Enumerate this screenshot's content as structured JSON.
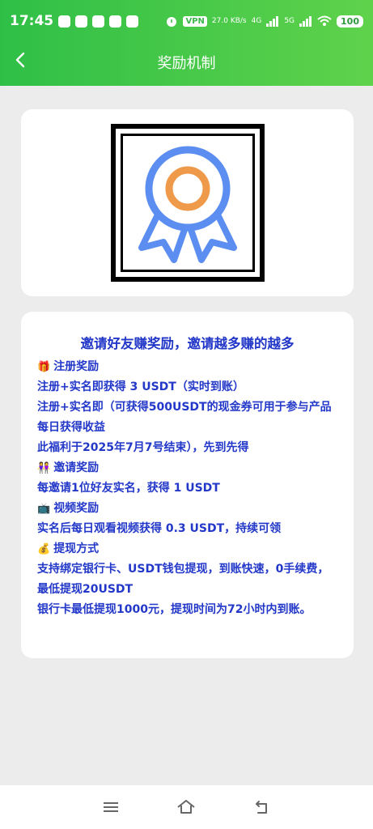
{
  "status_bar": {
    "time": "17:45",
    "vpn": "VPN",
    "speed": "27.0 KB/s",
    "network_4g": "4G",
    "network_5g": "5G",
    "battery": "100"
  },
  "header": {
    "title": "奖励机制",
    "back_icon": "chevron-left-icon"
  },
  "hero": {
    "icon": "award-ribbon-icon",
    "colors": {
      "ring": "#5b8ef0",
      "inner": "#ef9a4a"
    }
  },
  "rules": {
    "headline": "邀请好友赚奖励，邀请越多赚的越多",
    "section_register": "注册奖励",
    "register_line1": "注册+实名即获得 3 USDT（实时到账）",
    "register_line2": "注册+实名即（可获得500USDT的现金券可用于参与产品每日获得收益",
    "register_line3": "此福利于2025年7月7号结束），先到先得",
    "section_invite": "邀请奖励",
    "invite_line1": "每邀请1位好友实名，获得 1 USDT",
    "section_video": "视频奖励",
    "video_line1": "实名后每日观看视频获得 0.3 USDT，持续可领",
    "section_withdraw": "提现方式",
    "withdraw_line1": "支持绑定银行卡、USDT钱包提现，到账快速，0手续费，最低提现20USDT",
    "withdraw_line2": "银行卡最低提现1000元，提现时间为72小时内到账。"
  },
  "bottom_nav": {
    "menu_icon": "menu-icon",
    "home_icon": "home-icon",
    "back_icon": "back-icon"
  },
  "colors": {
    "header_start": "#2fbf47",
    "header_end": "#5fd24b",
    "text_accent": "#2338c9"
  }
}
